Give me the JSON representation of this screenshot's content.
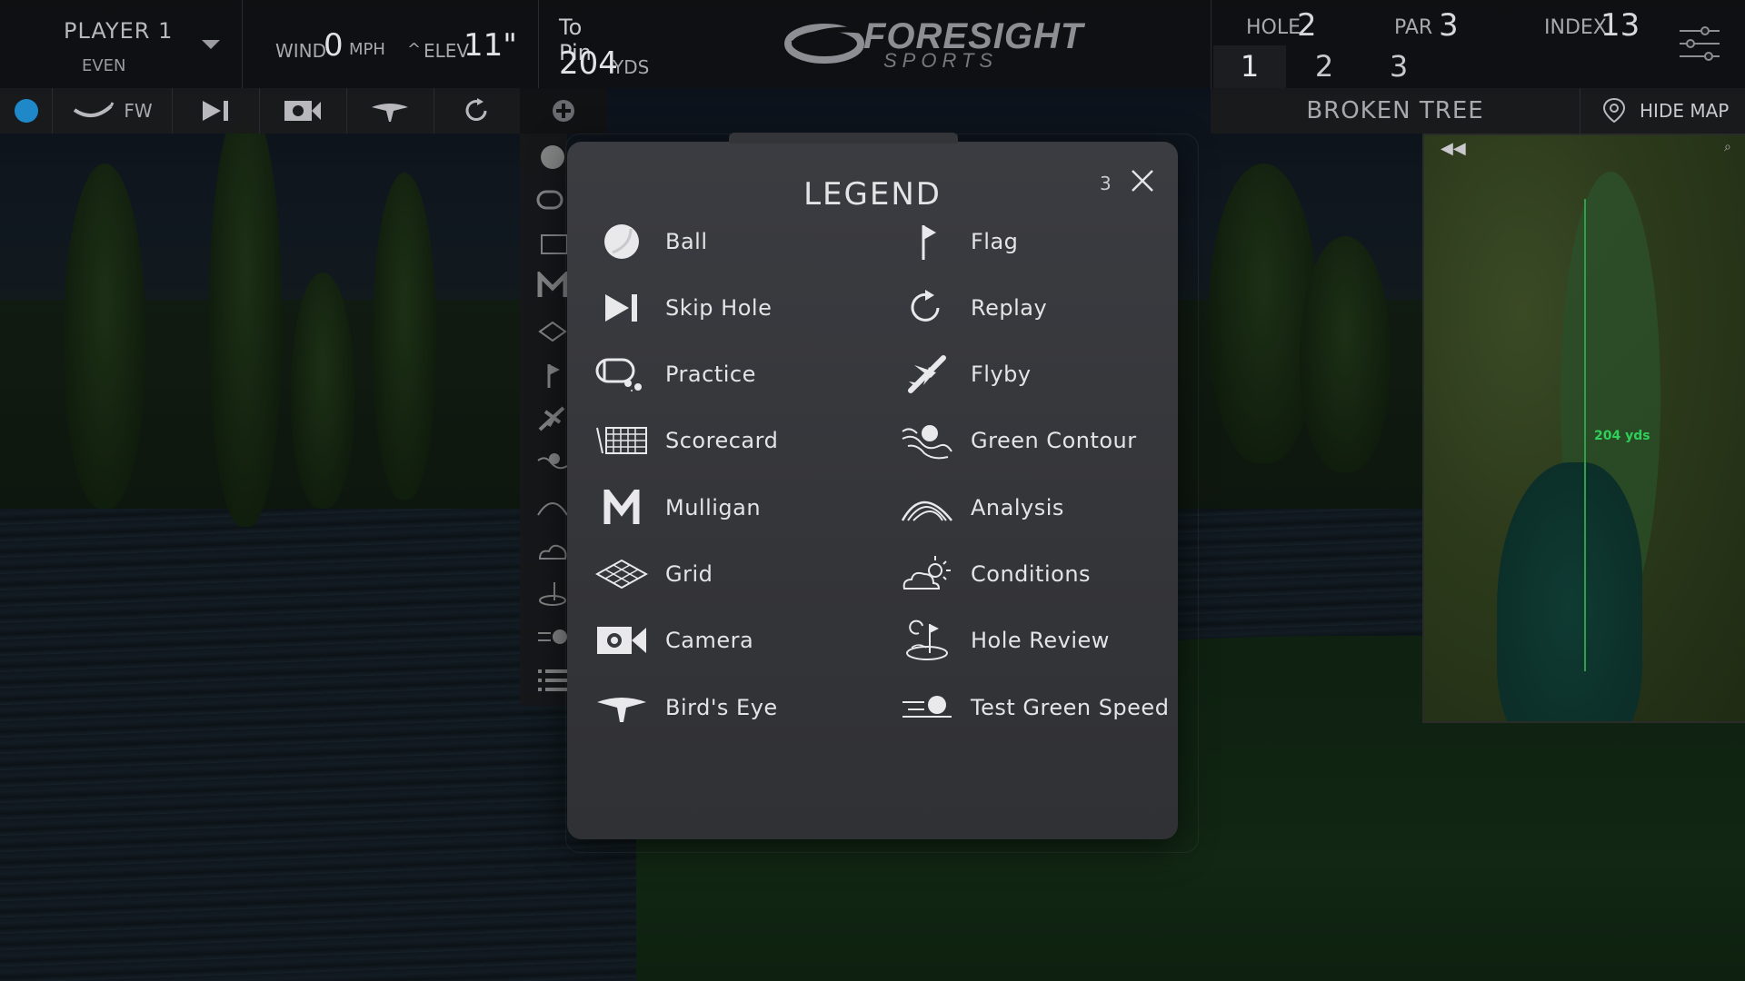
{
  "player": {
    "name": "PLAYER 1",
    "score": "EVEN"
  },
  "wind": {
    "label": "WIND",
    "value": "0",
    "unit": "MPH"
  },
  "elevation": {
    "arrow": "^",
    "label": "ELEV",
    "value": "11\""
  },
  "to_pin": {
    "label": "To Pin",
    "value": "204",
    "unit": "YDS"
  },
  "logo": {
    "main": "FORESIGHT",
    "sub": "SPORTS"
  },
  "hole": {
    "label": "HOLE",
    "value": "2"
  },
  "par": {
    "label": "PAR",
    "value": "3"
  },
  "index": {
    "label": "INDEX",
    "value": "13"
  },
  "hole_tabs": [
    "1",
    "2",
    "3"
  ],
  "toolbar": {
    "club_label": "FW"
  },
  "course": {
    "name": "BROKEN TREE",
    "hide_map_label": "HIDE MAP"
  },
  "minimap": {
    "distance_label": "204 yds"
  },
  "legend": {
    "title": "LEGEND",
    "count": "3",
    "left_items": [
      {
        "icon": "ball-icon",
        "label": "Ball"
      },
      {
        "icon": "skip-hole-icon",
        "label": "Skip Hole"
      },
      {
        "icon": "practice-icon",
        "label": "Practice"
      },
      {
        "icon": "scorecard-icon",
        "label": "Scorecard"
      },
      {
        "icon": "mulligan-icon",
        "label": "Mulligan"
      },
      {
        "icon": "grid-icon",
        "label": "Grid"
      },
      {
        "icon": "camera-icon",
        "label": "Camera"
      },
      {
        "icon": "birds-eye-icon",
        "label": "Bird's Eye"
      }
    ],
    "right_items": [
      {
        "icon": "flag-icon",
        "label": "Flag"
      },
      {
        "icon": "replay-icon",
        "label": "Replay"
      },
      {
        "icon": "flyby-icon",
        "label": "Flyby"
      },
      {
        "icon": "green-contour-icon",
        "label": "Green Contour"
      },
      {
        "icon": "analysis-icon",
        "label": "Analysis"
      },
      {
        "icon": "conditions-icon",
        "label": "Conditions"
      },
      {
        "icon": "hole-review-icon",
        "label": "Hole Review"
      },
      {
        "icon": "test-green-speed-icon",
        "label": "Test Green Speed"
      }
    ]
  },
  "colors": {
    "accent_blue": "#1e88c8",
    "panel": "#37383c",
    "text": "#e4e4e7"
  }
}
